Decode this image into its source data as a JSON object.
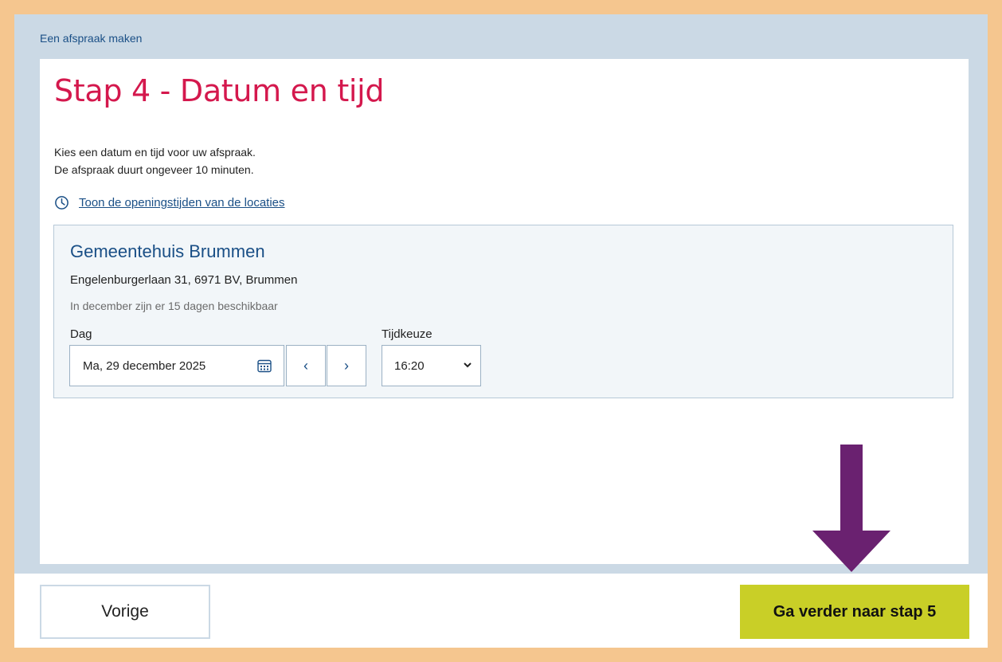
{
  "breadcrumb": "Een afspraak maken",
  "page_title": "Stap 4 - Datum en tijd",
  "intro": {
    "line1": "Kies een datum en tijd voor uw afspraak.",
    "line2": "De afspraak duurt ongeveer 10 minuten."
  },
  "hours_link": {
    "label": "Toon de openingstijden van de locaties",
    "icon": "clock-icon"
  },
  "location": {
    "name": "Gemeentehuis Brummen",
    "address": "Engelenburgerlaan 31, 6971 BV, Brummen",
    "availability": "In december zijn er 15 dagen beschikbaar"
  },
  "form": {
    "day_label": "Dag",
    "day_value": "Ma, 29 december 2025",
    "prev_symbol": "‹",
    "next_symbol": "›",
    "time_label": "Tijdkeuze",
    "time_value": "16:20"
  },
  "footer": {
    "prev_label": "Vorige",
    "next_label": "Ga verder naar stap 5"
  },
  "colors": {
    "title": "#d4184d",
    "link": "#1a4f86",
    "background": "#cbd9e5",
    "next_button": "#c9cf27",
    "arrow": "#6a2170",
    "outer_border": "#f5c68f"
  }
}
